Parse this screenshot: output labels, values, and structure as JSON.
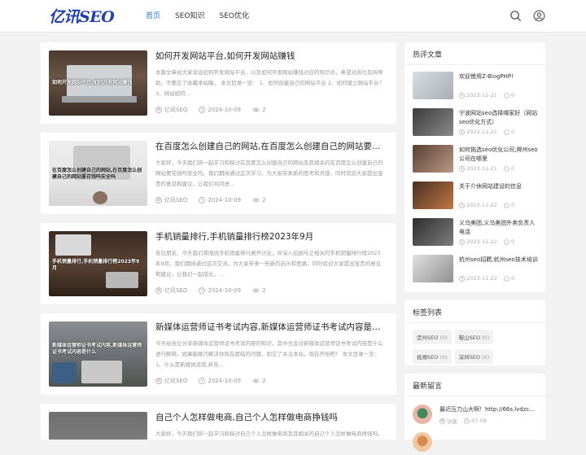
{
  "site": {
    "logo": "亿讯SEO"
  },
  "nav": [
    {
      "label": "首页",
      "active": true
    },
    {
      "label": "SEO知识",
      "active": false
    },
    {
      "label": "SEO优化",
      "active": false
    }
  ],
  "posts": [
    {
      "title": "如何开发网站平台,如何开发网站赚钱",
      "thumb_caption": "如何开发网站平台,如何开发网站赚钱",
      "excerpt": "本篇文章给大家谈谈如何开发网站平台，以及如何开发网站赚钱对应的知识点，希望对各位有所帮助，不要忘了收藏本站喔。 本文目录一览： 1、如何创建自己的网站平台 2、如何建立网站平台？ 3、网站如何...",
      "author": "亿讯SEO",
      "date": "2024-10-09",
      "views": "2"
    },
    {
      "title": "在百度怎么创建自己的网站,在百度怎么创建自己的网站要花钱吗",
      "thumb_caption": "在百度怎么创建自己的网站,在百度怎么创建自己的网站要花钱吗安全吗",
      "excerpt": "大家好，今天我们将一起学习和探讨在百度怎么创建自己的网站及其相关的在百度怎么创建自己的网站要花钱吗安全吗。我们期待通过这次学习，为大家带来新的思考和灵感，同时欢迎大家提出宝贵的意见和建议，让我们共同进...",
      "author": "亿讯SEO",
      "date": "2024-10-09",
      "views": "2"
    },
    {
      "title": "手机销量排行,手机销量排行榜2023年9月",
      "thumb_caption": "手机销量排行,手机销量排行榜2023年9月",
      "excerpt": "各位朋友，今天我们将围绕手机销量排行展开讨论，并深入挖掘与之相关的手机销量排行榜2023年9月。我们期待通过这次交流，为大家带来一些新的启示和思路，同时欢迎大家提出宝贵的意见和建议，让我们一起成长。...",
      "author": "亿讯SEO",
      "date": "2024-10-09",
      "views": "2"
    },
    {
      "title": "新媒体运营师证书考试内容,新媒体运营师证书考试内容是什么",
      "thumb_caption": "新媒体运营师证书考试内容,新媒体运营师证书考试内容是什么",
      "excerpt": "今天给各位分享新媒体运营师证书考试内容的知识，其中也会对新媒体运营师证书考试内容是什么进行解释，如果能碰巧解决你现在面临的问题，别忘了关注本站，现在开始吧！ 本文目录一览： 1、什么是新媒体运营,新告...",
      "author": "亿讯SEO",
      "date": "2024-10-09",
      "views": "2"
    },
    {
      "title": "自己个人怎样做电商,自己个人怎样做电商挣钱吗",
      "thumb_caption": "",
      "excerpt": "大家好，今天我们将一起学习和探讨自己个人怎样做电商及其相关的自己个人怎样做电商挣钱吗。",
      "author": "亿讯SEO",
      "date": "2024-10-09",
      "views": "2"
    }
  ],
  "hot": {
    "heading": "热评文章",
    "items": [
      {
        "title": "欢迎使用Z-BlogPHP!",
        "date": "2023-11-21",
        "comments": "0"
      },
      {
        "title": "宁波网站seo选择哪家好（网站seo优化方式）",
        "date": "2023-11-21",
        "comments": "0"
      },
      {
        "title": "如何挑选seo优化公司,柳州seo公司在哪里",
        "date": "2023-11-21",
        "comments": "0"
      },
      {
        "title": "关于介休网站建设的信息",
        "date": "2023-11-22",
        "comments": "0"
      },
      {
        "title": "义乌美团,义乌美团外卖负责人电话",
        "date": "2023-11-22",
        "comments": "0"
      },
      {
        "title": "杭州seo招聘,杭州seo技术培训",
        "date": "2023-11-22",
        "comments": "0"
      }
    ]
  },
  "tags": {
    "heading": "标签列表",
    "items": [
      {
        "name": "定州SEO",
        "count": "(0)"
      },
      {
        "name": "鞍山SEO",
        "count": "(0)"
      },
      {
        "name": "抚顺SEO",
        "count": "(0)"
      },
      {
        "name": "深圳SEO",
        "count": "(0)"
      }
    ]
  },
  "comments": {
    "heading": "最新留言",
    "items": [
      {
        "text": "最近压力山大啊！http://66s.lvdzc...",
        "author": "访客",
        "date": "07-08"
      },
      {
        "text": "",
        "author": "",
        "date": ""
      }
    ]
  }
}
